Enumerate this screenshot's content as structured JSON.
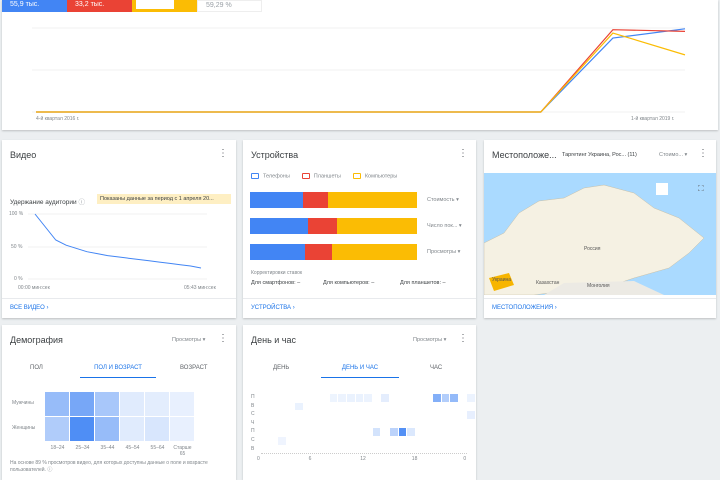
{
  "summary": {
    "tiles": [
      {
        "value": "55,9 тыс.",
        "color": "#4285f4"
      },
      {
        "value": "33,2 тыс.",
        "color": "#ea4335"
      },
      {
        "value": "",
        "color": "#fbbc04"
      },
      {
        "value": "59,29 %",
        "color": "#ffffff"
      }
    ]
  },
  "chart_data": {
    "type": "line",
    "x": [
      "4-й квартал 2016 г.",
      "",
      "",
      "",
      "",
      "",
      "",
      "",
      "",
      "1-й квартал 2019 г."
    ],
    "x_first_label": "4-й квартал 2016 г.",
    "x_last_label": "1-й квартал 2019 г.",
    "ylim": [
      0,
      100
    ],
    "series": [
      {
        "name": "blue",
        "color": "#4285f4",
        "values": [
          0,
          0,
          0,
          0,
          0,
          0,
          0,
          0,
          88,
          99
        ]
      },
      {
        "name": "red",
        "color": "#ea4335",
        "values": [
          0,
          0,
          0,
          0,
          0,
          0,
          0,
          0,
          98,
          96
        ]
      },
      {
        "name": "yellow",
        "color": "#fbbc04",
        "values": [
          0,
          0,
          0,
          0,
          0,
          0,
          0,
          0,
          94,
          68
        ]
      }
    ]
  },
  "video": {
    "title": "Видео",
    "retention_label": "Удержание аудитории",
    "notice": "Показаны данные за период с 1 апреля 20...",
    "y_ticks": [
      "100 %",
      "50 %",
      "0 %"
    ],
    "x_start": "00:00&nbsp;",
    "x_start_label": "00:00 &#1084;ин",
    "x_labels": [
      "00:00 мин:сек",
      "05:43 мин:сек"
    ],
    "retention": [
      100,
      80,
      60,
      52,
      47,
      42,
      39,
      36,
      34,
      32,
      30,
      28,
      26,
      24,
      22,
      20,
      17
    ],
    "footer": "Все видео"
  },
  "devices": {
    "title": "Устройства",
    "legend": [
      {
        "label": "Телефоны",
        "color": "#4285f4"
      },
      {
        "label": "Планшеты",
        "color": "#ea4335"
      },
      {
        "label": "Компьютеры",
        "color": "#fbbc04"
      }
    ],
    "rows": [
      {
        "metric": "Стоимость",
        "shares": [
          32,
          15,
          53
        ]
      },
      {
        "metric": "Число пок...",
        "shares": [
          35,
          17,
          48
        ]
      },
      {
        "metric": "Просмотры",
        "shares": [
          33,
          16,
          51
        ]
      }
    ],
    "bid_label": "Корректировки ставок",
    "bids": [
      "Для смартфонов: –",
      "Для компьютеров: –",
      "Для планшетов: –"
    ],
    "footer": "Устройства"
  },
  "location": {
    "title": "Местоположе...",
    "targeting": "Таргетинг Украина, Рос... (11)",
    "metric": "Стоимо...",
    "labels": [
      "Россия",
      "Украина",
      "Казахстан",
      "Монголия"
    ],
    "footer": "Местоположения"
  },
  "demo": {
    "title": "Демография",
    "metric": "Просмотры",
    "tabs": [
      "Пол",
      "Пол и возраст",
      "Возраст"
    ],
    "active_tab": 1,
    "rows": [
      "Мужчины",
      "Женщины"
    ],
    "cols": [
      "18–24",
      "25–34",
      "35–44",
      "45–54",
      "55–64",
      "Старше 65"
    ],
    "values": [
      [
        0.55,
        0.75,
        0.45,
        0.1,
        0.08,
        0.05
      ],
      [
        0.4,
        1.0,
        0.55,
        0.1,
        0.15,
        0.05
      ]
    ],
    "note": "На основе 89 % просмотров видео, для которых доступны данные о поле и возрасте пользователей."
  },
  "dayhour": {
    "title": "День и час",
    "metric": "Просмотры",
    "tabs": [
      "День",
      "День и час",
      "Час"
    ],
    "active_tab": 1,
    "days": [
      "П",
      "В",
      "С",
      "Ч",
      "П",
      "С",
      "В"
    ],
    "hour_ticks": [
      "0",
      "6",
      "12",
      "18",
      "0"
    ],
    "cells": [
      [
        0,
        8,
        0.04
      ],
      [
        0,
        9,
        0.05
      ],
      [
        0,
        10,
        0.06
      ],
      [
        0,
        11,
        0.06
      ],
      [
        0,
        12,
        0.05
      ],
      [
        0,
        14,
        0.1
      ],
      [
        0,
        20,
        0.7
      ],
      [
        0,
        21,
        0.4
      ],
      [
        0,
        22,
        0.6
      ],
      [
        0,
        24,
        0.05
      ],
      [
        1,
        4,
        0.06
      ],
      [
        2,
        24,
        0.08
      ],
      [
        4,
        13,
        0.2
      ],
      [
        4,
        15,
        0.35
      ],
      [
        4,
        16,
        1.0
      ],
      [
        4,
        17,
        0.15
      ],
      [
        5,
        2,
        0.03
      ]
    ]
  }
}
